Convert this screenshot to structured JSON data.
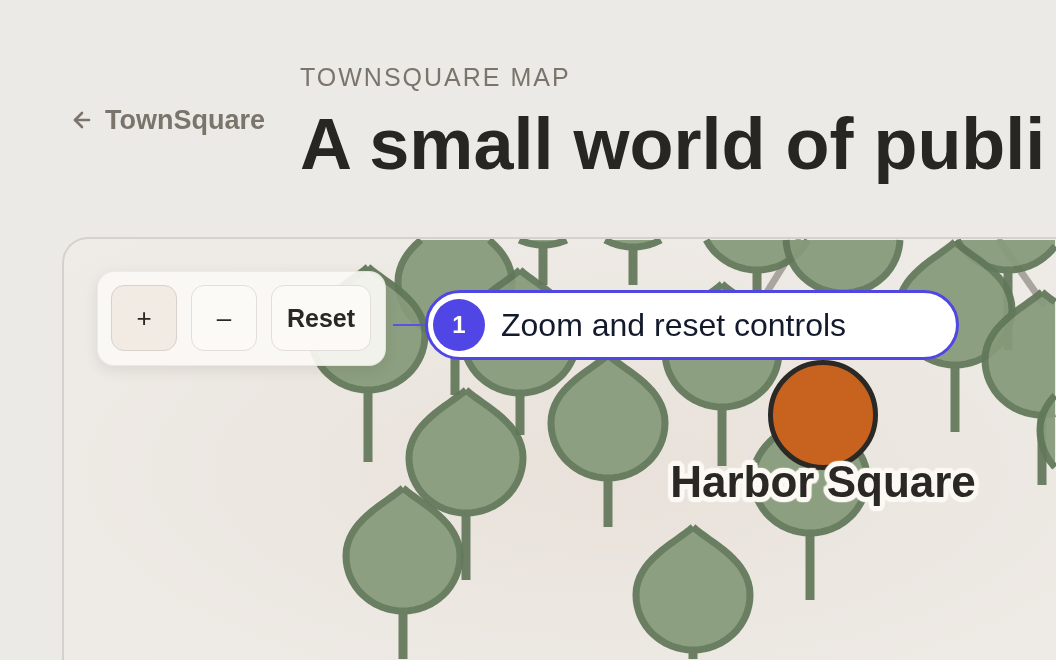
{
  "back_link": {
    "label": "TownSquare"
  },
  "eyebrow": "TOWNSQUARE MAP",
  "title": "A small world of publi",
  "map": {
    "controls": [
      {
        "kind": "zoom_in",
        "label": "+",
        "pressed": true
      },
      {
        "kind": "zoom_out",
        "label": "–",
        "pressed": false
      },
      {
        "kind": "reset",
        "label": "Reset",
        "pressed": false
      }
    ],
    "places": [
      {
        "name": "Harbor Square"
      }
    ],
    "annotations": [
      {
        "number": "1",
        "label": "Zoom and reset controls"
      }
    ]
  }
}
